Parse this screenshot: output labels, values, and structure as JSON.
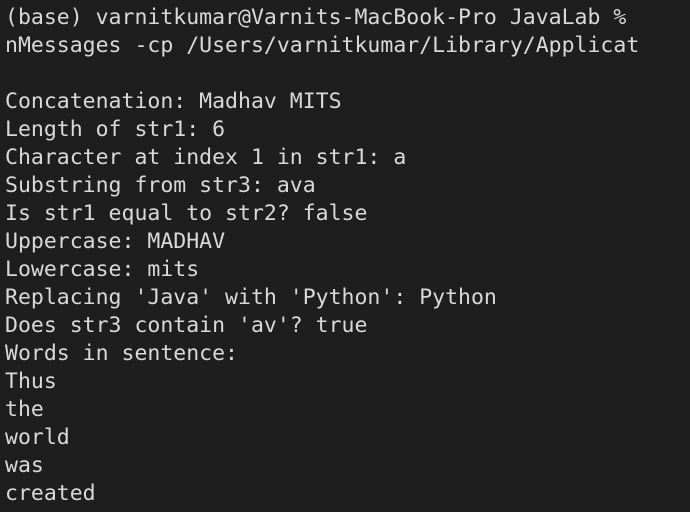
{
  "terminal": {
    "prompt_line": "(base) varnitkumar@Varnits-MacBook-Pro JavaLab % ",
    "command_line": "nMessages -cp /Users/varnitkumar/Library/Applicat",
    "output": [
      "Concatenation: Madhav MITS",
      "Length of str1: 6",
      "Character at index 1 in str1: a",
      "Substring from str3: ava",
      "Is str1 equal to str2? false",
      "Uppercase: MADHAV",
      "Lowercase: mits",
      "Replacing 'Java' with 'Python': Python",
      "Does str3 contain 'av'? true",
      "Words in sentence:",
      "Thus",
      "the",
      "world",
      "was",
      "created"
    ]
  }
}
